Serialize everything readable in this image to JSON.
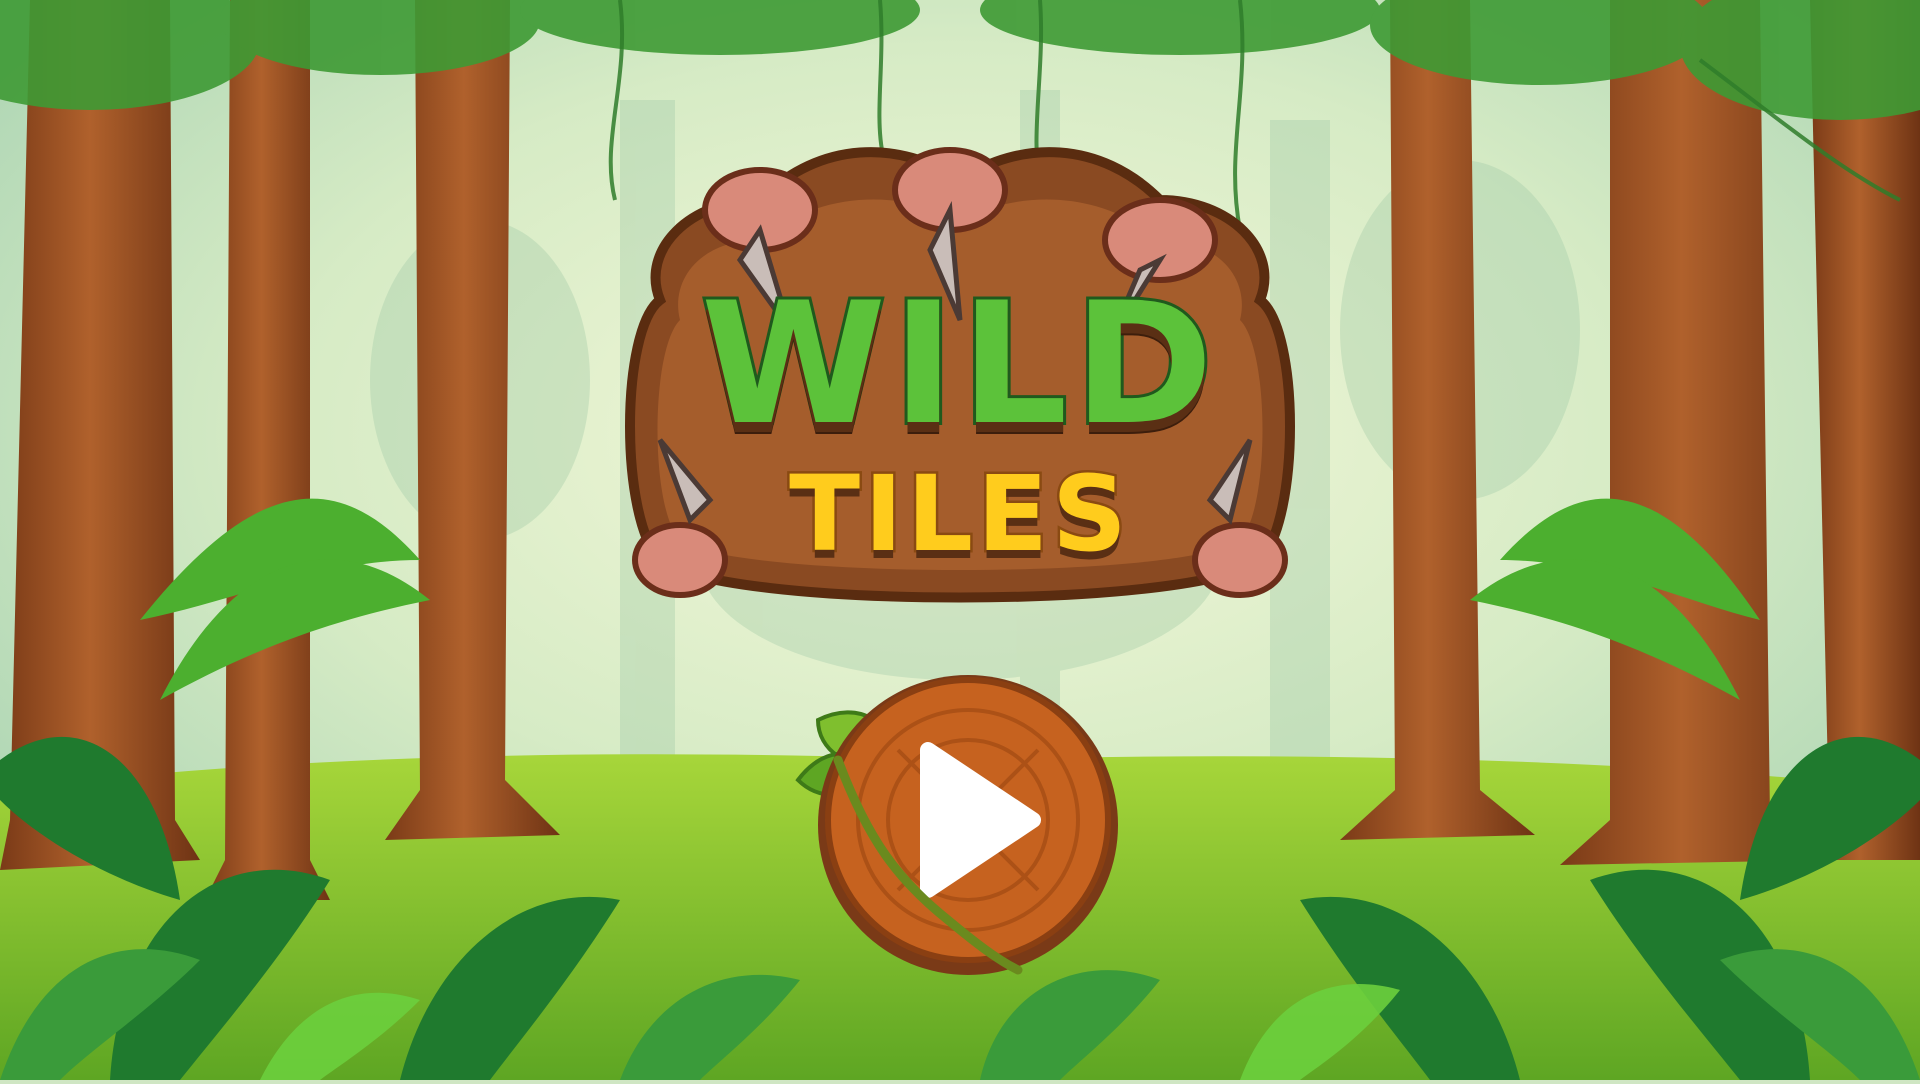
{
  "game": {
    "title_line1": "WILD",
    "title_line2": "TILES"
  },
  "play_button": {
    "icon": "play-icon",
    "wood_color": "#c6621f",
    "icon_color": "#ffffff"
  },
  "palette": {
    "sky": "#e3f0cf",
    "grass": "#7fbf2e",
    "trunk": "#a8572a",
    "leaf_dark": "#1f7a2e",
    "leaf_light": "#6ccf3d"
  }
}
